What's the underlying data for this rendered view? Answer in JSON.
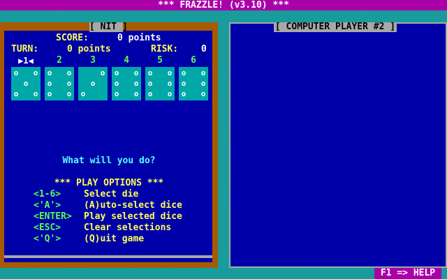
{
  "title": "*** FRAZZLE! (v3.10) ***",
  "player_panel": {
    "name": "[ NIT ]",
    "score_label": "SCORE:",
    "score_value": "0 points",
    "turn_label": "TURN:",
    "turn_value": "0 points",
    "risk_label": "RISK:",
    "risk_value": "0",
    "dice": [
      {
        "label": "1",
        "value": 5,
        "selected": true
      },
      {
        "label": "2",
        "value": 6,
        "selected": false
      },
      {
        "label": "3",
        "value": 3,
        "selected": false
      },
      {
        "label": "4",
        "value": 6,
        "selected": false
      },
      {
        "label": "5",
        "value": 6,
        "selected": false
      },
      {
        "label": "6",
        "value": 6,
        "selected": false
      }
    ],
    "prompt": "What will you do?",
    "options_header": "*** PLAY OPTIONS ***",
    "options": [
      {
        "key": "<1-6>",
        "desc": "Select die"
      },
      {
        "key": "<'A'>",
        "desc": "(A)uto-select dice"
      },
      {
        "key": "<ENTER>",
        "desc": "Play selected dice"
      },
      {
        "key": "<ESC>",
        "desc": "Clear selections"
      },
      {
        "key": "<'Q'>",
        "desc": "(Q)uit game"
      }
    ]
  },
  "computer_panel": {
    "name": "[ COMPUTER PLAYER #2 ]"
  },
  "help_hint": "F1 => HELP",
  "colors": {
    "background": "#1aa6a6",
    "title_bar": "#aa00aa",
    "panel_blue": "#0000a8",
    "frame_brown": "#a85a00",
    "die_face": "#00a8a8",
    "label_yellow": "#ffff55",
    "key_green": "#55ff55",
    "prompt_cyan": "#55ffff"
  }
}
